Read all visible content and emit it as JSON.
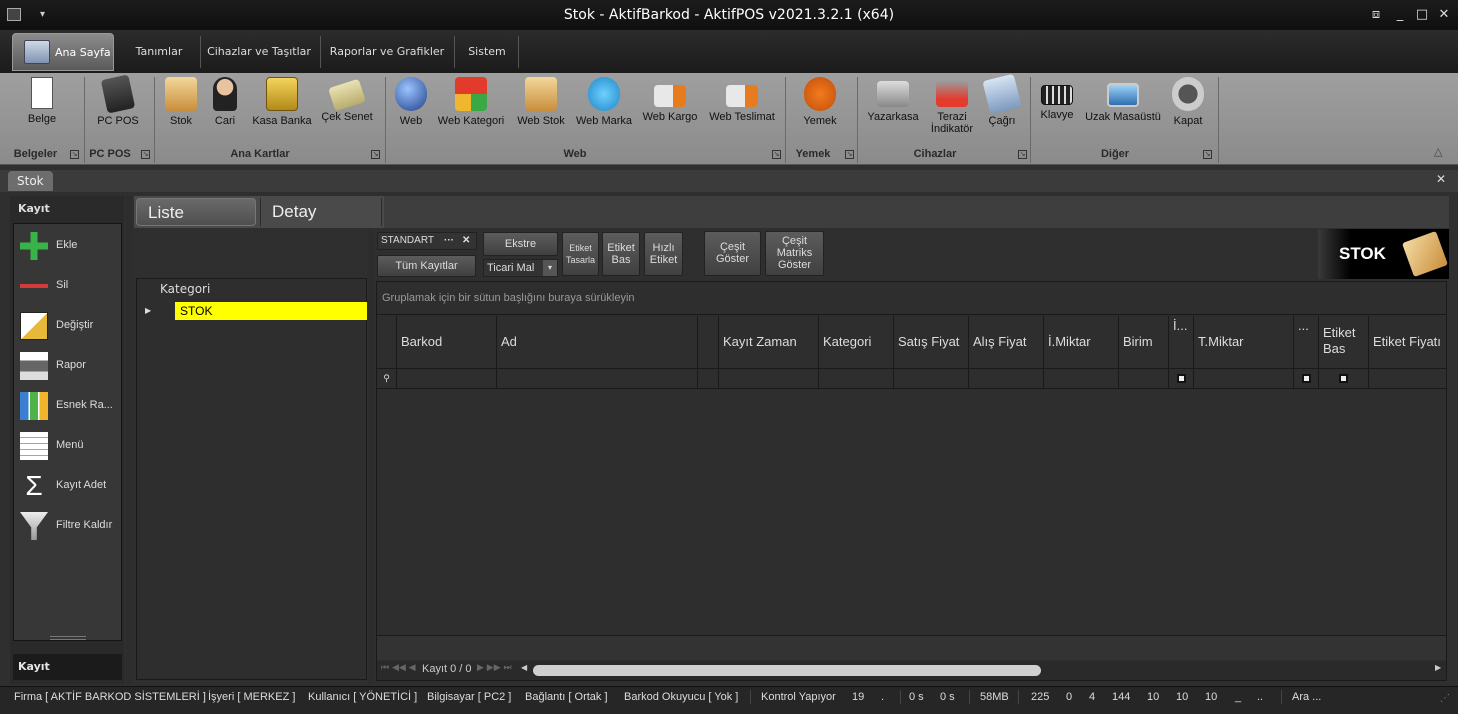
{
  "window": {
    "title": "Stok - AktifBarkod - AktifPOS v2021.3.2.1 (x64)"
  },
  "ribbon_tabs": [
    "Ana Sayfa",
    "Tanımlar",
    "Cihazlar ve Taşıtlar",
    "Raporlar ve Grafikler",
    "Sistem"
  ],
  "ribbon": {
    "buttons": [
      {
        "label": "Belge",
        "icon": "document-icon"
      },
      {
        "label": "PC POS",
        "icon": "pos-terminal-icon"
      },
      {
        "label": "Stok",
        "icon": "stock-box-icon"
      },
      {
        "label": "Cari",
        "icon": "person-icon"
      },
      {
        "label": "Kasa Banka",
        "icon": "safe-icon"
      },
      {
        "label": "Çek Senet",
        "icon": "cheque-icon"
      },
      {
        "label": "Web",
        "icon": "globe-icon"
      },
      {
        "label": "Web Kategori",
        "icon": "cubes-icon"
      },
      {
        "label": "Web Stok",
        "icon": "web-stock-icon"
      },
      {
        "label": "Web Marka",
        "icon": "badge-icon"
      },
      {
        "label": "Web Kargo",
        "icon": "truck-icon"
      },
      {
        "label": "Web Teslimat",
        "icon": "delivery-truck-icon"
      },
      {
        "label": "Yemek",
        "icon": "fork-icon"
      },
      {
        "label": "Yazarkasa",
        "icon": "cash-register-icon"
      },
      {
        "label": "Terazi",
        "label2": "İndikatör",
        "icon": "scale-icon"
      },
      {
        "label": "Çağrı",
        "icon": "phone-icon"
      },
      {
        "label": "Klavye",
        "icon": "keyboard-icon"
      },
      {
        "label": "Uzak Masaüstü",
        "icon": "remote-desktop-icon"
      },
      {
        "label": "Kapat",
        "icon": "power-icon"
      }
    ],
    "groups": [
      "Belgeler",
      "PC POS",
      "Ana Kartlar",
      "Web",
      "Yemek",
      "Cihazlar",
      "Diğer"
    ]
  },
  "doc_tab": "Stok",
  "left_panel": {
    "header": "Kayıt",
    "footer": "Kayıt",
    "items": [
      "Ekle",
      "Sil",
      "Değiştir",
      "Rapor",
      "Esnek Ra...",
      "Menü",
      "Kayıt Adet",
      "Filtre Kaldır"
    ]
  },
  "sub_tabs": [
    "Liste",
    "Detay"
  ],
  "category": {
    "header": "Kategori",
    "selected": "STOK"
  },
  "toolbar": {
    "view": "STANDART",
    "view_dots": "···",
    "all_records": "Tüm Kayıtlar",
    "ekstre": "Ekstre",
    "filter_value": "Ticari Mal",
    "etiket_tasarla": [
      "Etiket",
      "Tasarla"
    ],
    "etiket_bas": [
      "Etiket",
      "Bas"
    ],
    "hizli_etiket": [
      "Hızlı",
      "Etiket"
    ],
    "cesit_goster": [
      "Çeşit",
      "Göster"
    ],
    "cesit_matriks": [
      "Çeşit",
      "Matriks",
      "Göster"
    ]
  },
  "brand": {
    "label": "STOK"
  },
  "grid": {
    "group_hint": "Gruplamak için bir sütun başlığını buraya sürükleyin",
    "columns": [
      "Barkod",
      "Ad",
      "",
      "Kayıt Zaman",
      "Kategori",
      "Satış Fiyat",
      "Alış Fiyat",
      "İ.Miktar",
      "Birim",
      "İ...",
      "T.Miktar",
      "...",
      "Etiket Bas",
      "Etiket Fiyatı"
    ],
    "nav_text": "Kayıt 0 / 0"
  },
  "status": [
    "Firma [ AKTİF BARKOD SİSTEMLERİ ]",
    "İşyeri [ MERKEZ ]",
    "Kullanıcı [ YÖNETİCİ ]",
    "Bilgisayar [ PC2 ]",
    "Bağlantı [ Ortak ]",
    "Barkod Okuyucu [ Yok ]",
    "Kontrol Yapıyor",
    "19",
    ".",
    "0 s",
    "0 s",
    "58MB",
    "225",
    "0",
    "4",
    "144",
    "10",
    "10",
    "10",
    "_",
    "..",
    "Ara ..."
  ]
}
